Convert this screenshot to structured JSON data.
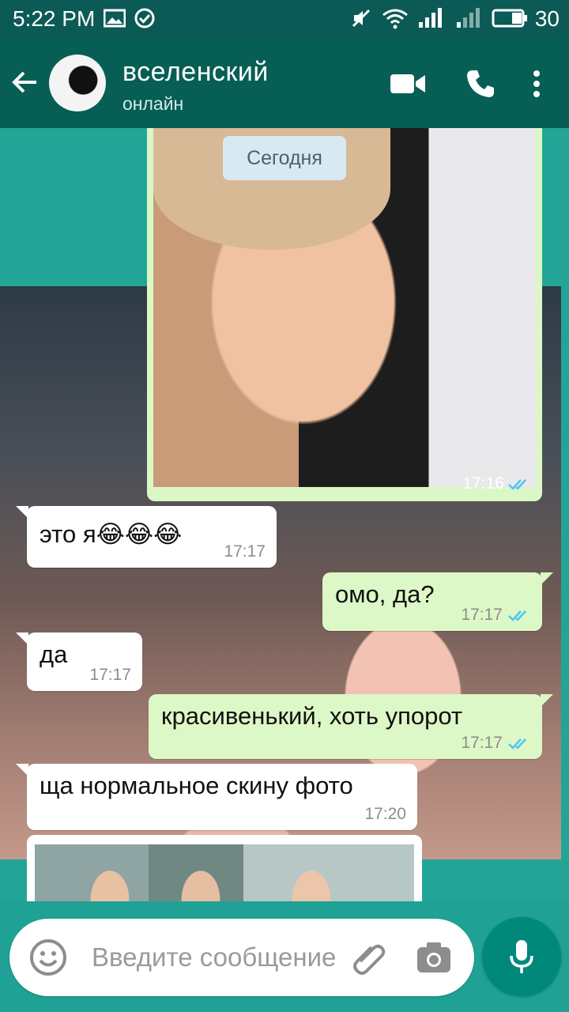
{
  "status_bar": {
    "time": "5:22 PM",
    "battery_level": "30",
    "icons": [
      "image-icon",
      "check-circle-icon",
      "mute-icon",
      "wifi-icon",
      "signal-icon",
      "signal-icon",
      "battery-icon"
    ]
  },
  "header": {
    "name": "вселенский",
    "status": "онлайн",
    "icons": [
      "back-arrow-icon",
      "video-call-icon",
      "phone-icon",
      "more-vert-icon"
    ]
  },
  "chat": {
    "date_separator": "Сегодня",
    "photo_message_time": "17:16",
    "messages": [
      {
        "direction": "in",
        "text": "это я😂😂😂",
        "time": "17:17"
      },
      {
        "direction": "out",
        "text": "омо, да?",
        "time": "17:17"
      },
      {
        "direction": "in",
        "text": "да",
        "time": "17:17"
      },
      {
        "direction": "out",
        "text": "красивенький, хоть упорот",
        "time": "17:17"
      },
      {
        "direction": "in",
        "text": "ща нормальное скину фото",
        "time": "17:20"
      }
    ]
  },
  "input": {
    "placeholder": "Введите сообщение",
    "icons": [
      "emoji-icon",
      "attach-icon",
      "camera-icon",
      "mic-icon"
    ]
  },
  "colors": {
    "header_bg": "#075e54",
    "status_bg": "#0b5a55",
    "outgoing_bubble": "#dcf8c6",
    "incoming_bubble": "#ffffff",
    "read_ticks": "#4fc3f7",
    "mic_button": "#00897b"
  }
}
